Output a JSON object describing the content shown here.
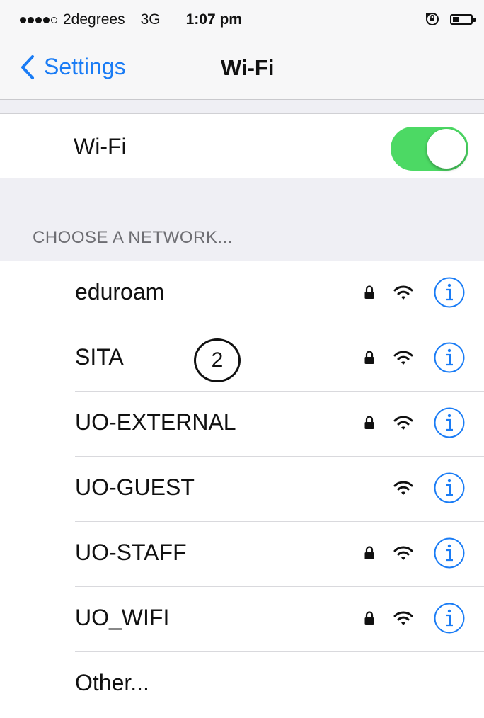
{
  "status_bar": {
    "carrier": "2degrees",
    "network_type": "3G",
    "time": "1:07 pm",
    "signal_bars": 4,
    "signal_max": 5
  },
  "nav": {
    "back_label": "Settings",
    "title": "Wi-Fi"
  },
  "wifi_toggle": {
    "label": "Wi-Fi",
    "on": true
  },
  "section_header": "CHOOSE A NETWORK...",
  "networks": [
    {
      "name": "eduroam",
      "secured": true
    },
    {
      "name": "SITA",
      "secured": true
    },
    {
      "name": "UO-EXTERNAL",
      "secured": true
    },
    {
      "name": "UO-GUEST",
      "secured": false
    },
    {
      "name": "UO-STAFF",
      "secured": true
    },
    {
      "name": "UO_WIFI",
      "secured": true
    }
  ],
  "other_label": "Other...",
  "callout": "2",
  "colors": {
    "accent": "#1a7cf5",
    "toggle_on": "#4cd964",
    "group_background": "#efeff4"
  }
}
